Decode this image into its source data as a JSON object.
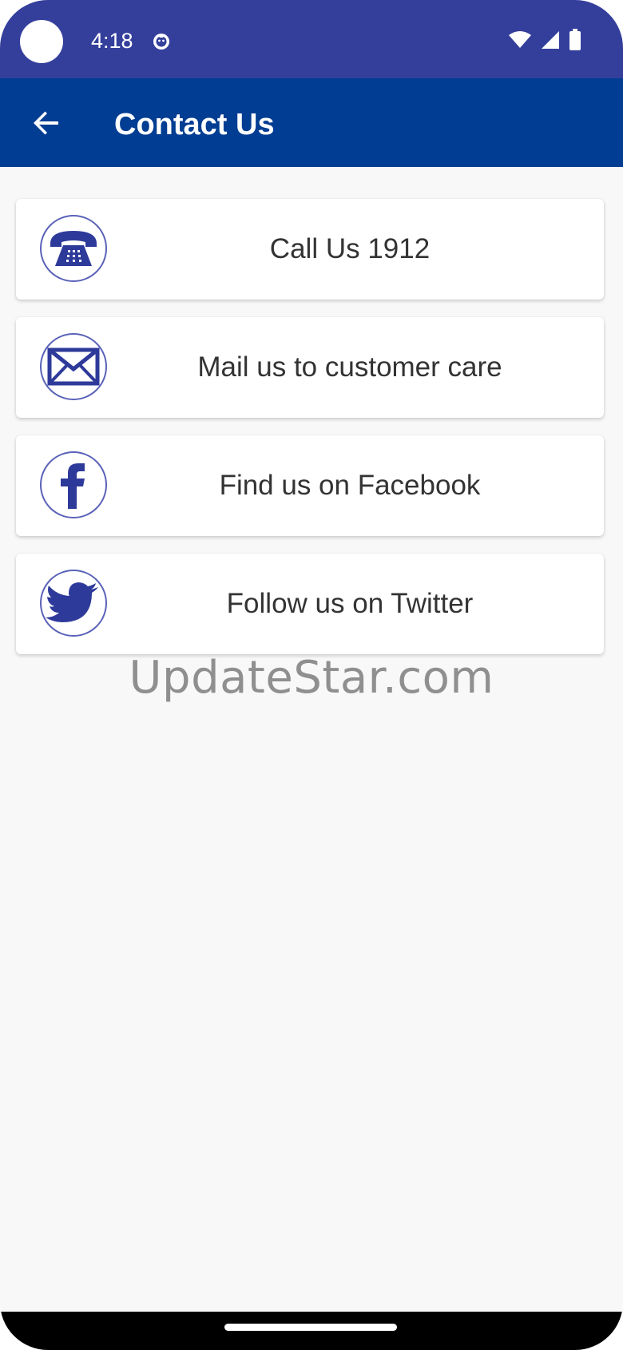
{
  "status_bar": {
    "time": "4:18"
  },
  "app_bar": {
    "title": "Contact Us",
    "back_icon": "arrow-back-icon"
  },
  "contact_options": [
    {
      "label": "Call Us 1912",
      "icon": "telephone-icon"
    },
    {
      "label": "Mail us to customer care",
      "icon": "envelope-icon"
    },
    {
      "label": "Find us on Facebook",
      "icon": "facebook-icon"
    },
    {
      "label": "Follow us on Twitter",
      "icon": "twitter-bird-icon"
    }
  ],
  "watermark": "UpdateStar.com",
  "colors": {
    "status_bar": "#343f9c",
    "app_bar": "#013d92",
    "icon_blue": "#2e3a9a",
    "background": "#f8f8f8"
  }
}
